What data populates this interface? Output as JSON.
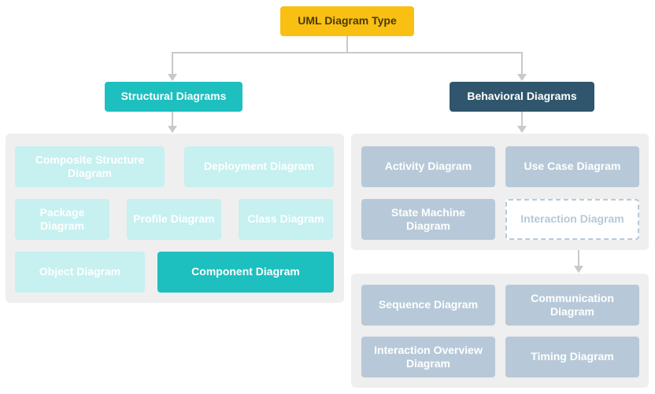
{
  "root": {
    "label": "UML Diagram Type"
  },
  "categories": {
    "structural": {
      "label": "Structural Diagrams"
    },
    "behavioral": {
      "label": "Behavioral Diagrams"
    }
  },
  "structural_leaves": {
    "composite": "Composite Structure Diagram",
    "deployment": "Deployment Diagram",
    "package": "Package Diagram",
    "profile": "Profile Diagram",
    "class": "Class Diagram",
    "object": "Object Diagram",
    "component": "Component Diagram"
  },
  "behavioral_leaves": {
    "activity": "Activity Diagram",
    "usecase": "Use Case Diagram",
    "statemachine": "State Machine Diagram",
    "interaction": "Interaction Diagram"
  },
  "interaction_leaves": {
    "sequence": "Sequence Diagram",
    "communication": "Communication Diagram",
    "overview": "Interaction Overview Diagram",
    "timing": "Timing Diagram"
  },
  "colors": {
    "root_bg": "#f9c013",
    "teal": "#1dbfbf",
    "navy": "#2f566c",
    "group_bg": "#efefef",
    "cyan_leaf": "#c7f0f0",
    "blue_leaf": "#b7c9d8",
    "line": "#c9c9c9"
  }
}
